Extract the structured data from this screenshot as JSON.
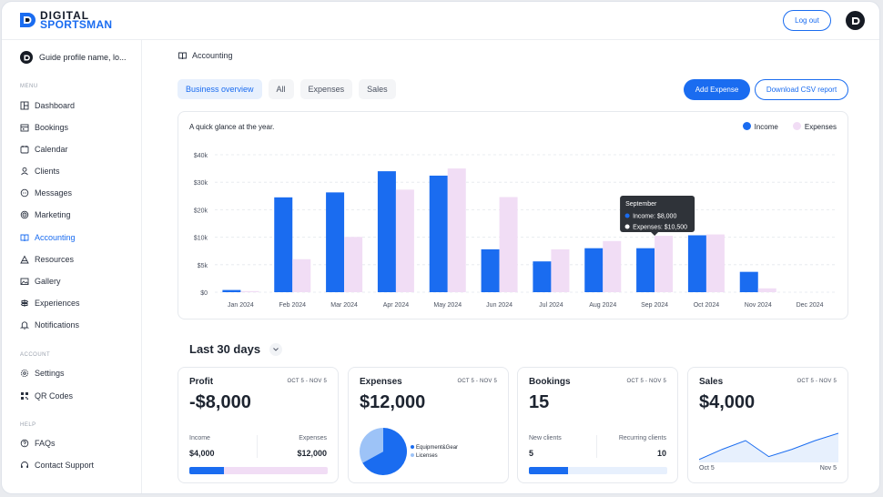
{
  "brand": {
    "line1": "DIGITAL",
    "line2": "SPORTSMAN"
  },
  "header": {
    "logout_label": "Log out"
  },
  "sidebar": {
    "profile_name": "Guide profile name, lo...",
    "menu_label": "MENU",
    "menu": [
      {
        "label": "Dashboard",
        "icon": "dashboard-icon"
      },
      {
        "label": "Bookings",
        "icon": "bookings-icon"
      },
      {
        "label": "Calendar",
        "icon": "calendar-icon"
      },
      {
        "label": "Clients",
        "icon": "clients-icon"
      },
      {
        "label": "Messages",
        "icon": "messages-icon"
      },
      {
        "label": "Marketing",
        "icon": "marketing-icon"
      },
      {
        "label": "Accounting",
        "icon": "accounting-icon",
        "active": true
      },
      {
        "label": "Resources",
        "icon": "resources-icon"
      },
      {
        "label": "Gallery",
        "icon": "gallery-icon"
      },
      {
        "label": "Experiences",
        "icon": "experiences-icon"
      },
      {
        "label": "Notifications",
        "icon": "notifications-icon"
      }
    ],
    "account_label": "ACCOUNT",
    "account": [
      {
        "label": "Settings",
        "icon": "settings-icon"
      },
      {
        "label": "QR Codes",
        "icon": "qr-code-icon"
      }
    ],
    "help_label": "HELP",
    "help": [
      {
        "label": "FAQs",
        "icon": "help-icon"
      },
      {
        "label": "Contact Support",
        "icon": "headset-icon"
      }
    ]
  },
  "page": {
    "breadcrumb": "Accounting",
    "tabs": [
      {
        "label": "Business overview",
        "active": true
      },
      {
        "label": "All"
      },
      {
        "label": "Expenses"
      },
      {
        "label": "Sales"
      }
    ],
    "add_expense_label": "Add Expense",
    "download_label": "Download CSV report"
  },
  "chart_data": {
    "type": "bar",
    "caption": "A quick glance at the year.",
    "categories": [
      "Jan 2024",
      "Feb 2024",
      "Mar 2024",
      "Apr 2024",
      "May 2024",
      "Jun 2024",
      "Jul 2024",
      "Aug 2024",
      "Sep 2024",
      "Oct 2024",
      "Nov 2024",
      "Dec 2024"
    ],
    "series": [
      {
        "name": "Income",
        "color": "#1a6cf0",
        "values": [
          400,
          24500,
          26300,
          34000,
          32400,
          7800,
          5600,
          8000,
          8000,
          10700,
          3700,
          0
        ]
      },
      {
        "name": "Expenses",
        "color": "#f1ddf5",
        "values": [
          200,
          6000,
          10100,
          27300,
          35000,
          24600,
          7800,
          9300,
          10500,
          11000,
          700,
          0
        ]
      }
    ],
    "yticks": [
      "$0",
      "$5k",
      "$10k",
      "$20k",
      "$30k",
      "$40k"
    ],
    "tick_values": [
      0,
      5000,
      10000,
      20000,
      30000,
      40000
    ],
    "ylim": [
      0,
      40000
    ],
    "grid": true,
    "legend_position": "top-right",
    "tooltip": {
      "category_index": 8,
      "title": "September",
      "line1": "Income: $8,000",
      "line2": "Expenses: $10,500"
    }
  },
  "summary": {
    "title": "Last 30 days",
    "cards": {
      "profit": {
        "title": "Profit",
        "range": "OCT 5 - NOV 5",
        "value": "-$8,000",
        "left_label": "Income",
        "left_value": "$4,000",
        "right_label": "Expenses",
        "right_value": "$12,000",
        "bar_fraction": 0.25
      },
      "expenses": {
        "title": "Expenses",
        "range": "OCT 5 - NOV 5",
        "value": "$12,000",
        "pie": [
          {
            "label": "Equipment&Gear",
            "color": "#1a6cf0",
            "fraction": 0.67
          },
          {
            "label": "Licenses",
            "color": "#9dc3f7",
            "fraction": 0.33
          }
        ]
      },
      "bookings": {
        "title": "Bookings",
        "range": "OCT 5 - NOV 5",
        "value": "15",
        "left_label": "New clients",
        "left_value": "5",
        "right_label": "Recurring clients",
        "right_value": "10",
        "bar_fraction": 0.28
      },
      "sales": {
        "title": "Sales",
        "range": "OCT 5 - NOV 5",
        "value": "$4,000",
        "start_label": "Oct 5",
        "end_label": "Nov 5",
        "trend": [
          0.1,
          0.45,
          0.75,
          0.2,
          0.45,
          0.75,
          1.0
        ]
      }
    }
  }
}
